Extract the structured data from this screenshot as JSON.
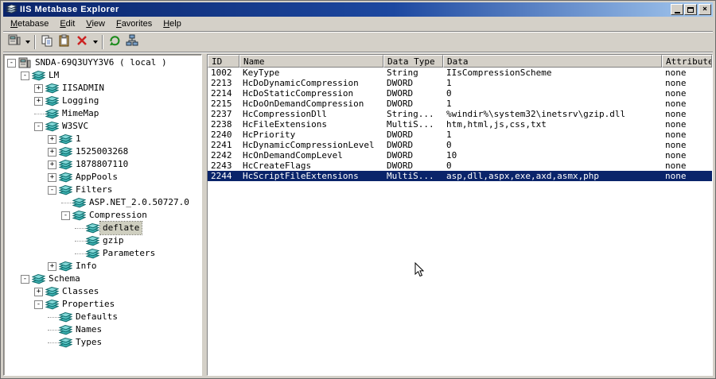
{
  "colors": {
    "chrome": "#d4d0c8",
    "title_a": "#0a246a",
    "title_b": "#a6caf0",
    "sel": "#0a246a",
    "tree_sel": "#cfcfc0"
  },
  "window": {
    "title": "IIS Metabase Explorer",
    "controls": [
      {
        "name": "minimize",
        "glyph": "minimize"
      },
      {
        "name": "maximize",
        "glyph": "maximize"
      },
      {
        "name": "close",
        "glyph": "close"
      }
    ]
  },
  "menu": {
    "items": [
      {
        "label": "Metabase"
      },
      {
        "label": "Edit"
      },
      {
        "label": "View"
      },
      {
        "label": "Favorites"
      },
      {
        "label": "Help"
      }
    ]
  },
  "toolbar": {
    "buttons": [
      {
        "type": "button",
        "name": "connect",
        "icon": "computer",
        "dropdown": true
      },
      {
        "type": "separator"
      },
      {
        "type": "button",
        "name": "copy",
        "icon": "copy"
      },
      {
        "type": "button",
        "name": "paste",
        "icon": "paste"
      },
      {
        "type": "button",
        "name": "delete",
        "icon": "delete",
        "dropdown": true
      },
      {
        "type": "separator"
      },
      {
        "type": "button",
        "name": "refresh",
        "icon": "refresh"
      },
      {
        "type": "button",
        "name": "network",
        "icon": "network"
      }
    ]
  },
  "tree": {
    "nodes": [
      {
        "label": "SNDA-69Q3UYY3V6 ( local )",
        "depth": 0,
        "expand": "minus",
        "icon": "computer"
      },
      {
        "label": "LM",
        "depth": 1,
        "expand": "minus",
        "icon": "db"
      },
      {
        "label": "IISADMIN",
        "depth": 2,
        "expand": "plus",
        "icon": "db"
      },
      {
        "label": "Logging",
        "depth": 2,
        "expand": "plus",
        "icon": "db"
      },
      {
        "label": "MimeMap",
        "depth": 2,
        "expand": "none",
        "icon": "db"
      },
      {
        "label": "W3SVC",
        "depth": 2,
        "expand": "minus",
        "icon": "db"
      },
      {
        "label": "1",
        "depth": 3,
        "expand": "plus",
        "icon": "db"
      },
      {
        "label": "1525003268",
        "depth": 3,
        "expand": "plus",
        "icon": "db"
      },
      {
        "label": "1878807110",
        "depth": 3,
        "expand": "plus",
        "icon": "db"
      },
      {
        "label": "AppPools",
        "depth": 3,
        "expand": "plus",
        "icon": "db"
      },
      {
        "label": "Filters",
        "depth": 3,
        "expand": "minus",
        "icon": "db"
      },
      {
        "label": "ASP.NET_2.0.50727.0",
        "depth": 4,
        "expand": "none",
        "icon": "db"
      },
      {
        "label": "Compression",
        "depth": 4,
        "expand": "minus",
        "icon": "db"
      },
      {
        "label": "deflate",
        "depth": 5,
        "expand": "none",
        "icon": "db",
        "selected": true
      },
      {
        "label": "gzip",
        "depth": 5,
        "expand": "none",
        "icon": "db"
      },
      {
        "label": "Parameters",
        "depth": 5,
        "expand": "none",
        "icon": "db"
      },
      {
        "label": "Info",
        "depth": 3,
        "expand": "plus",
        "icon": "db"
      },
      {
        "label": "Schema",
        "depth": 1,
        "expand": "minus",
        "icon": "db"
      },
      {
        "label": "Classes",
        "depth": 2,
        "expand": "plus",
        "icon": "db"
      },
      {
        "label": "Properties",
        "depth": 2,
        "expand": "minus",
        "icon": "db"
      },
      {
        "label": "Defaults",
        "depth": 3,
        "expand": "none",
        "icon": "db"
      },
      {
        "label": "Names",
        "depth": 3,
        "expand": "none",
        "icon": "db"
      },
      {
        "label": "Types",
        "depth": 3,
        "expand": "none",
        "icon": "db"
      }
    ]
  },
  "list": {
    "columns": [
      "ID",
      "Name",
      "Data Type",
      "Data",
      "Attributes"
    ],
    "rows": [
      {
        "id": "1002",
        "name": "KeyType",
        "type": "String",
        "data": "IIsCompressionScheme",
        "attributes": "none"
      },
      {
        "id": "2213",
        "name": "HcDoDynamicCompression",
        "type": "DWORD",
        "data": "1",
        "attributes": "none"
      },
      {
        "id": "2214",
        "name": "HcDoStaticCompression",
        "type": "DWORD",
        "data": "0",
        "attributes": "none"
      },
      {
        "id": "2215",
        "name": "HcDoOnDemandCompression",
        "type": "DWORD",
        "data": "1",
        "attributes": "none"
      },
      {
        "id": "2237",
        "name": "HcCompressionDll",
        "type": "String...",
        "data": "%windir%\\system32\\inetsrv\\gzip.dll",
        "attributes": "none"
      },
      {
        "id": "2238",
        "name": "HcFileExtensions",
        "type": "MultiS...",
        "data": "htm,html,js,css,txt",
        "attributes": "none"
      },
      {
        "id": "2240",
        "name": "HcPriority",
        "type": "DWORD",
        "data": "1",
        "attributes": "none"
      },
      {
        "id": "2241",
        "name": "HcDynamicCompressionLevel",
        "type": "DWORD",
        "data": "0",
        "attributes": "none"
      },
      {
        "id": "2242",
        "name": "HcOnDemandCompLevel",
        "type": "DWORD",
        "data": "10",
        "attributes": "none"
      },
      {
        "id": "2243",
        "name": "HcCreateFlags",
        "type": "DWORD",
        "data": "0",
        "attributes": "none"
      },
      {
        "id": "2244",
        "name": "HcScriptFileExtensions",
        "type": "MultiS...",
        "data": "asp,dll,aspx,exe,axd,asmx,php",
        "attributes": "none",
        "selected": true
      }
    ]
  }
}
